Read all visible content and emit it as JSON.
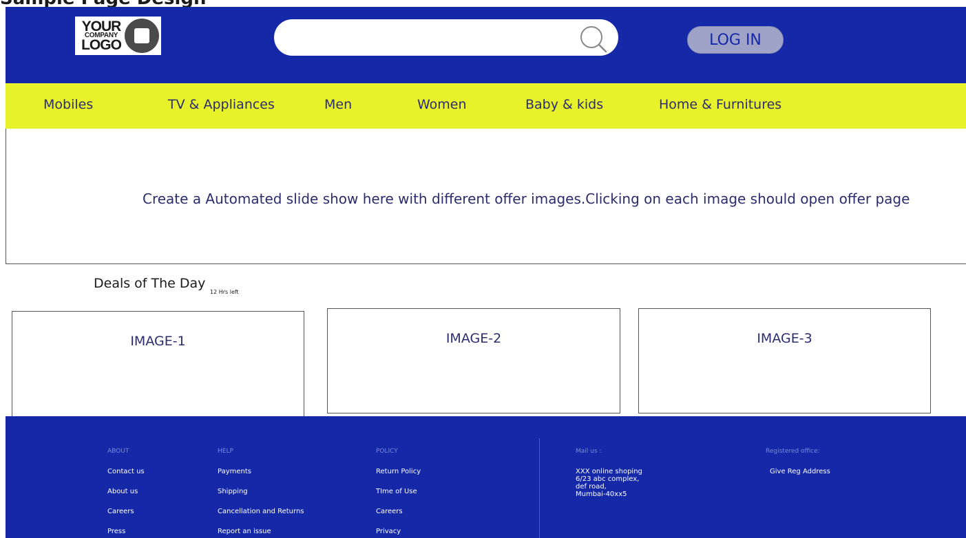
{
  "page": {
    "title": "Sample Page Design"
  },
  "header": {
    "logo": {
      "line1": "YOUR",
      "line2": "COMPANY",
      "line3": "LOGO"
    },
    "search": {
      "value": "",
      "placeholder": "",
      "icon": "search-icon"
    },
    "login_label": "LOG IN"
  },
  "colors": {
    "header_bg": "#1428a8",
    "nav_bg": "#e8f22a",
    "login_bg": "#9fa3c8"
  },
  "nav": {
    "items": [
      {
        "label": "Mobiles"
      },
      {
        "label": "TV & Appliances"
      },
      {
        "label": "Men"
      },
      {
        "label": "Women"
      },
      {
        "label": "Baby & kids"
      },
      {
        "label": "Home & Furnitures"
      }
    ]
  },
  "slideshow": {
    "text": "Create a Automated slide show here with different offer images.Clicking on each image should open offer page"
  },
  "deals": {
    "title": "Deals of The Day",
    "timer": "12 Hrs left",
    "cards": [
      {
        "label": "IMAGE-1"
      },
      {
        "label": "IMAGE-2"
      },
      {
        "label": "IMAGE-3"
      }
    ]
  },
  "footer": {
    "about": {
      "heading": "ABOUT",
      "links": [
        "Contact us",
        "About us",
        "Careers",
        "Press"
      ]
    },
    "help": {
      "heading": "HELP",
      "links": [
        "Payments",
        "Shipping",
        "Cancellation and Returns",
        "Report an issue"
      ]
    },
    "policy": {
      "heading": "POLICY",
      "links": [
        "Return Policy",
        "TIme of Use",
        "Careers",
        "Privacy"
      ]
    },
    "mail": {
      "heading": "Mail us :",
      "lines": [
        "XXX online shoping",
        "6/23 abc complex,",
        "def road,",
        "Mumbai-40xx5"
      ]
    },
    "registered": {
      "heading": "Registered office:",
      "text": "Give Reg Address"
    }
  }
}
